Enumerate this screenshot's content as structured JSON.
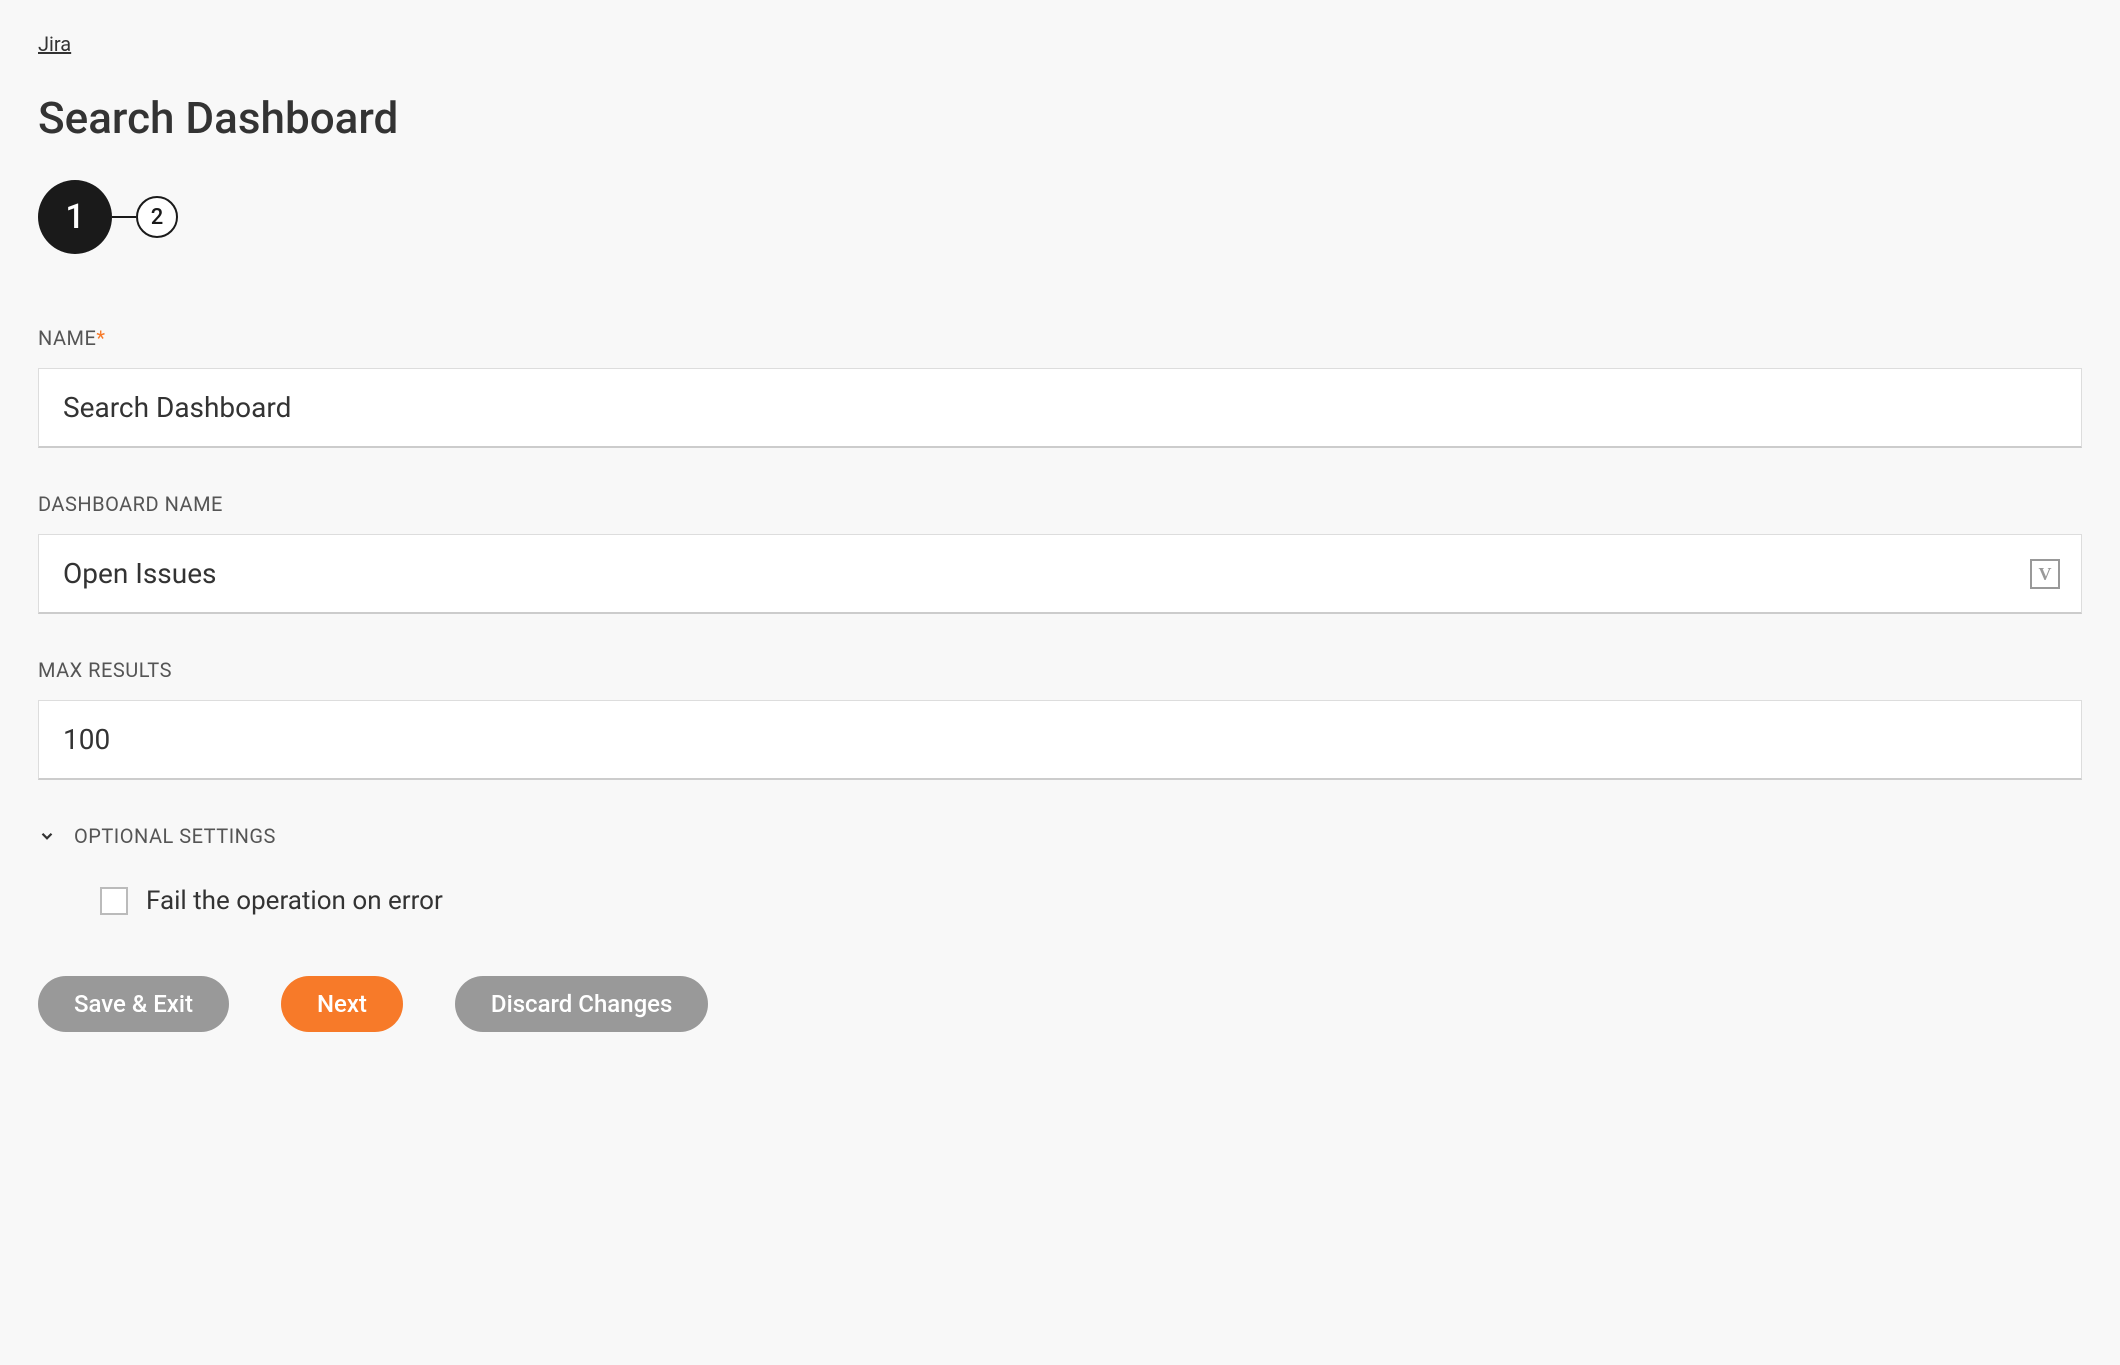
{
  "breadcrumb": "Jira",
  "page_title": "Search Dashboard",
  "stepper": {
    "step1": "1",
    "step2": "2"
  },
  "form": {
    "name_label": "Name",
    "name_value": "Search Dashboard",
    "dashboard_name_label": "Dashboard Name",
    "dashboard_name_value": "Open Issues",
    "dashboard_name_icon": "V",
    "max_results_label": "Max Results",
    "max_results_value": "100"
  },
  "optional": {
    "title": "Optional Settings",
    "fail_on_error_label": "Fail the operation on error"
  },
  "buttons": {
    "save_exit": "Save & Exit",
    "next": "Next",
    "discard": "Discard Changes"
  }
}
